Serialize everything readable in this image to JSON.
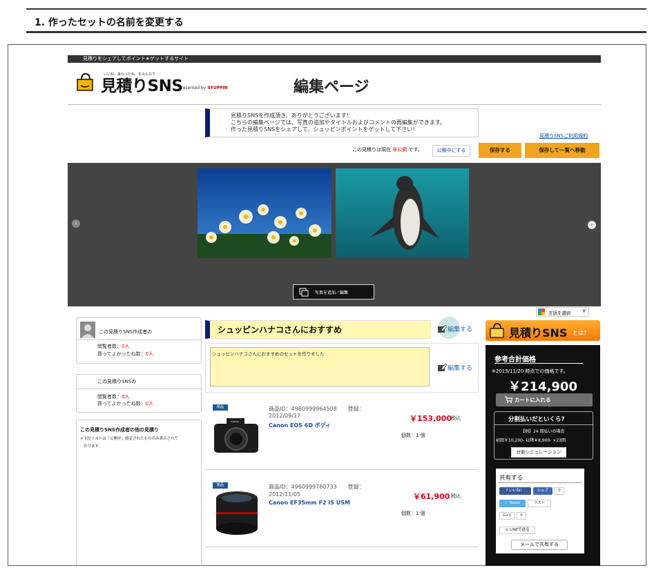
{
  "step": {
    "title": "1. 作ったセットの名前を変更する"
  },
  "site": {
    "tagline": "見積りをシェアしてポイント★ゲットするサイト",
    "logo_small": "いいね、良かったね、をみんなで",
    "logo_main": "見積りSNS",
    "presented_by": "Presented by ",
    "presented_brand": "SYUPPIN",
    "page_heading": "編集ページ"
  },
  "notice": {
    "line1": "見積りSNSを作成頂き、ありがとうございます！",
    "line2": "こちらの編集ページでは、写真の追加やタイトルおよびコメントの再編集ができます。",
    "line3": "作った見積りSNSをシェアして、シュッピンポイントをゲットして下さい！"
  },
  "terms_link": "見積りSNSご利用規約",
  "status": {
    "prefix": "この見積りは現在 ",
    "state": "非公開",
    "suffix": " です。"
  },
  "buttons": {
    "publish": "公開中にする",
    "save": "保存する",
    "save_move": "保存して一覧へ移動",
    "add_photo": "写真を追加／編集",
    "cart": "カートに入れる",
    "simulation": "分割シミュレーション",
    "mail_share": "メールで共有する"
  },
  "lang": {
    "label": "言語を選択"
  },
  "creator": {
    "title": "この見積りSNS作成者の",
    "views_label": "閲覧者数：",
    "views_value": "0人",
    "likes_label": "買ってよかったね数：",
    "likes_value": "0人"
  },
  "sns_stats": {
    "title": "この見積りSNSの",
    "views_label": "閲覧者数：",
    "views_value": "0人",
    "likes_label": "買ってよかったね数：",
    "likes_value": "0人"
  },
  "others": {
    "title": "この見積りSNS作成者の他の見積り",
    "note1": "※下記リストは「公開中」設定されたもののみ表示されて",
    "note2": "おります。"
  },
  "recommend": {
    "title": "シュッピンハナコさんにおすすめ",
    "edit_label": "編集する",
    "description": "シュッピンハナコさんにおすすめのセットを作りました",
    "desc_edit_label": "編集する"
  },
  "items": [
    {
      "badge": "新品",
      "id_line": "商品ID：4960999964508　　登録：",
      "date": "2012/09/17",
      "name": "Canon EOS 6D ボディ",
      "price": "￥153,000",
      "tax": "税込",
      "qty": "個数：1 個"
    },
    {
      "badge": "新品",
      "id_line": "商品ID：4960999780733　　登録：",
      "date": "2012/11/05",
      "name": "Canon EF35mm F2 IS USM",
      "price": "￥61,900",
      "tax": "税込",
      "qty": "個数：1 個"
    }
  ],
  "sidebar": {
    "banner_text": "見積りSNS",
    "banner_q": "とは?",
    "ref_title": "参考合計価格",
    "ref_date": "※2015/11/20 時点での価格です。",
    "ref_total": "￥214,900",
    "split_title": "分割払いだといくら?",
    "split_line1": "【例】24 回払いの場合",
    "split_line2": "初回￥10,200- 以降￥8,900- ×23回",
    "share_title": "共有する",
    "share": {
      "like": "いいね！",
      "like_count": "0",
      "share": "シェア",
      "share_count": "0",
      "tweet": "Tweet",
      "list": "リスト",
      "gplus": "G+1",
      "gplus_count": "0",
      "line": "LINEで送る"
    }
  },
  "colors": {
    "accent_orange": "#f0a51e",
    "navy": "#0c1d6e",
    "price_red": "#e0001a",
    "highlight_yellow": "#fff7b3"
  }
}
